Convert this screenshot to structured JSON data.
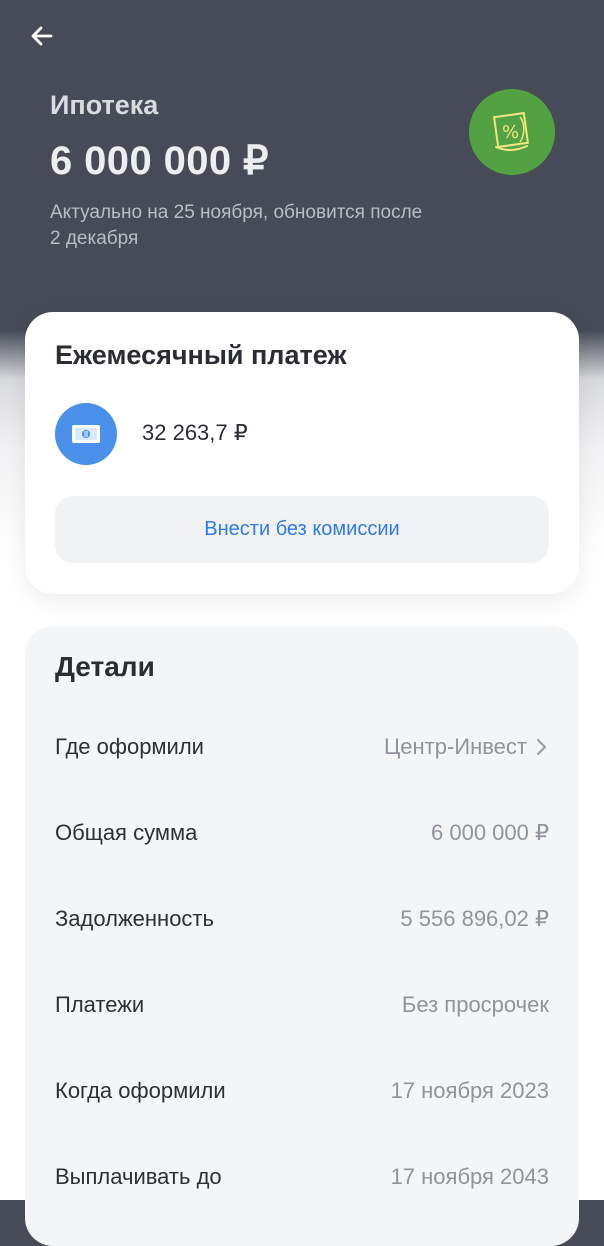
{
  "header": {
    "title": "Ипотека",
    "amount": "6 000 000 ₽",
    "subtitle": "Актуально на 25 ноября, обновится после 2 декабря",
    "back_icon": "back-arrow-icon",
    "bank_logo_icon": "bank-logo-icon",
    "bank_logo_color": "#52a143"
  },
  "payment": {
    "title": "Ежемесячный платеж",
    "amount": "32 263,7 ₽",
    "icon": "cash-icon",
    "icon_color": "#4a8fea",
    "button_label": "Внести без комиссии"
  },
  "details": {
    "title": "Детали",
    "rows": [
      {
        "label": "Где оформили",
        "value": "Центр-Инвест"
      },
      {
        "label": "Общая сумма",
        "value": "6 000 000 ₽"
      },
      {
        "label": "Задолженность",
        "value": "5 556 896,02 ₽"
      },
      {
        "label": "Платежи",
        "value": "Без просрочек"
      },
      {
        "label": "Когда оформили",
        "value": "17 ноября 2023"
      },
      {
        "label": "Выплачивать до",
        "value": "17 ноября 2043"
      }
    ]
  }
}
